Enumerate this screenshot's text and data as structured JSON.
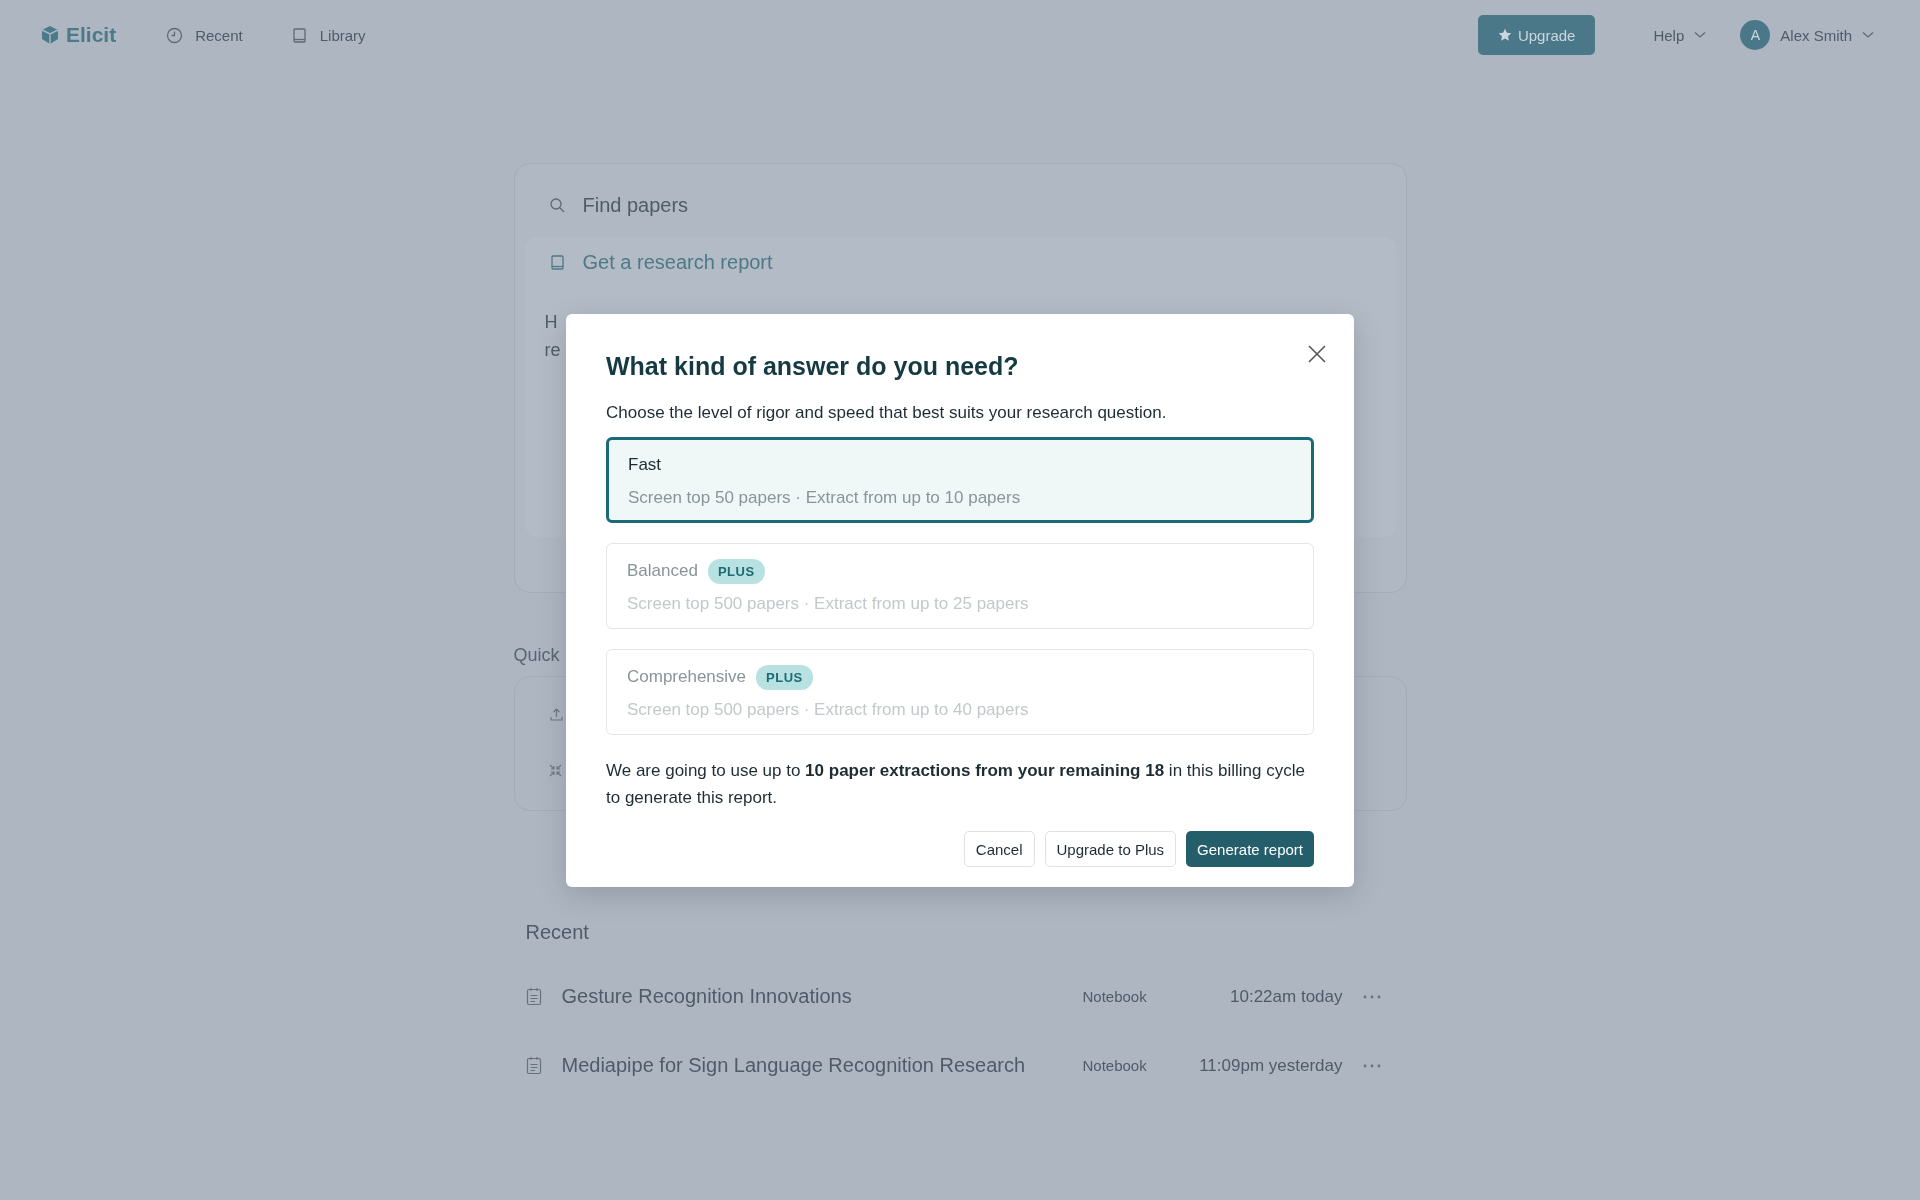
{
  "nav": {
    "logo": "Elicit",
    "links": [
      {
        "label": "Recent"
      },
      {
        "label": "Library"
      }
    ],
    "upgrade": "Upgrade",
    "help": "Help",
    "user": {
      "initial": "A",
      "name": "Alex Smith"
    }
  },
  "search_card": {
    "find": "Find papers",
    "report": "Get a research report",
    "partial_lines": [
      "H",
      "re"
    ]
  },
  "quick": {
    "label": "Quick"
  },
  "recent": {
    "title": "Recent",
    "items": [
      {
        "title": "Gesture Recognition Innovations",
        "type": "Notebook",
        "time": "10:22am today"
      },
      {
        "title": "Mediapipe for Sign Language Recognition Research",
        "type": "Notebook",
        "time": "11:09pm yesterday"
      }
    ]
  },
  "modal": {
    "title": "What kind of answer do you need?",
    "subtitle": "Choose the level of rigor and speed that best suits your research question.",
    "options": [
      {
        "name": "Fast",
        "description": "Screen top 50 papers · Extract from up to 10 papers",
        "selected": true,
        "disabled": false
      },
      {
        "name": "Balanced",
        "badge": "PLUS",
        "description": "Screen top 500 papers · Extract from up to 25 papers",
        "selected": false,
        "disabled": true
      },
      {
        "name": "Comprehensive",
        "badge": "PLUS",
        "description": "Screen top 500 papers · Extract from up to 40 papers",
        "selected": false,
        "disabled": true
      }
    ],
    "notice": "We are going to use up to **10 paper extractions from your remaining 18** in this billing cycle to generate this report.",
    "buttons": [
      {
        "label": "Cancel",
        "kind": "secondary"
      },
      {
        "label": "Upgrade to Plus",
        "kind": "secondary"
      },
      {
        "label": "Generate report",
        "kind": "primary"
      }
    ]
  }
}
